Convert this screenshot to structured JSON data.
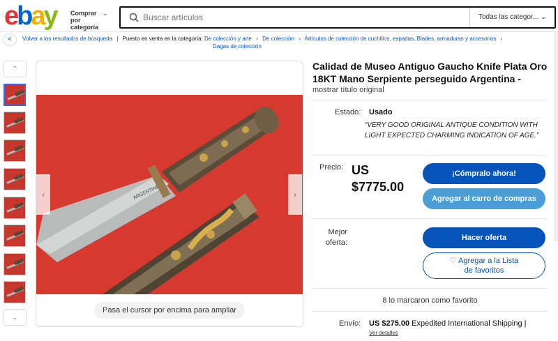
{
  "header": {
    "logo": [
      "e",
      "b",
      "a",
      "y"
    ],
    "shop_by_category": "Comprar por categoría",
    "search_placeholder": "Buscar artículos",
    "search_category": "Todas las categor...",
    "category_chevron_icon": "chevron-down-icon",
    "search_icon": "search-icon"
  },
  "breadcrumb": {
    "back": "Volver a los resultados de búsqueda",
    "listed_in": "Puesto en venta en la categoría:",
    "items": [
      "De colección y arte",
      "De colección",
      "Artículos de colección de cuchillos, espadas, Blades, armaduras y accesorios",
      "Dagas de colección"
    ]
  },
  "gallery": {
    "thumb_count": 8,
    "zoom_hint": "Pasa el cursor por encima para ampliar",
    "prev_icon": "chevron-left-icon",
    "next_icon": "chevron-right-icon"
  },
  "item": {
    "title": "Calidad de Museo Antiguo Gaucho Knife Plata Oro 18KT Mano Serpiente perseguido Argentina -",
    "original_title": "mostrar título original",
    "condition_label": "Estado:",
    "condition_value": "Usado",
    "condition_desc": "“VERY GOOD ORIGINAL ANTIQUE CONDITION WITH LIGHT EXPECTED CHARMING INDICATION OF AGE.”",
    "price_label": "Precio:",
    "price_currency": "US",
    "price_value": "$7775.00",
    "buy_now": "¡Cómpralo ahora!",
    "add_to_cart": "Agregar al carro de compras",
    "best_offer_label": "Mejor oferta:",
    "make_offer": "Hacer oferta",
    "watch_line1": "♡ Agregar a la Lista",
    "watch_line2": "de favoritos",
    "watchers": "8 lo marcaron como favorito",
    "shipping_label": "Envío:",
    "shipping_price": "US $275.00",
    "shipping_method": "Expedited International Shipping |",
    "shipping_details": "Ver detalles"
  },
  "colors": {
    "primary": "#0654ba",
    "secondary": "#4b9ed6",
    "background_red": "#d63a2f"
  }
}
